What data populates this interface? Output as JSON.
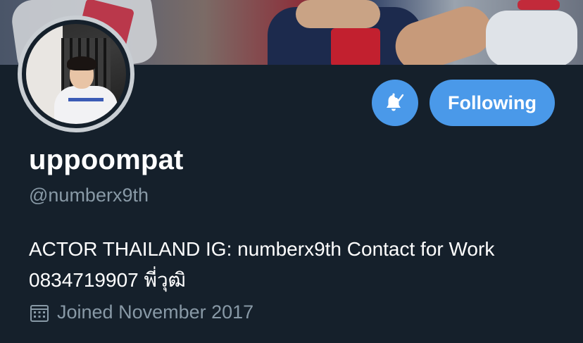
{
  "profile": {
    "display_name": "uppoompat",
    "handle": "@numberx9th",
    "bio": "ACTOR THAILAND IG: numberx9th Contact for Work 0834719907 พี่วุฒิ",
    "joined": "Joined November 2017"
  },
  "actions": {
    "follow_label": "Following",
    "notify_icon": "bell-check-icon"
  },
  "colors": {
    "background": "#15202b",
    "accent": "#4a99e9",
    "muted_text": "#8899a6",
    "primary_text": "#ffffff",
    "avatar_ring": "#c9ced3"
  },
  "icons": {
    "calendar": "calendar-icon"
  }
}
